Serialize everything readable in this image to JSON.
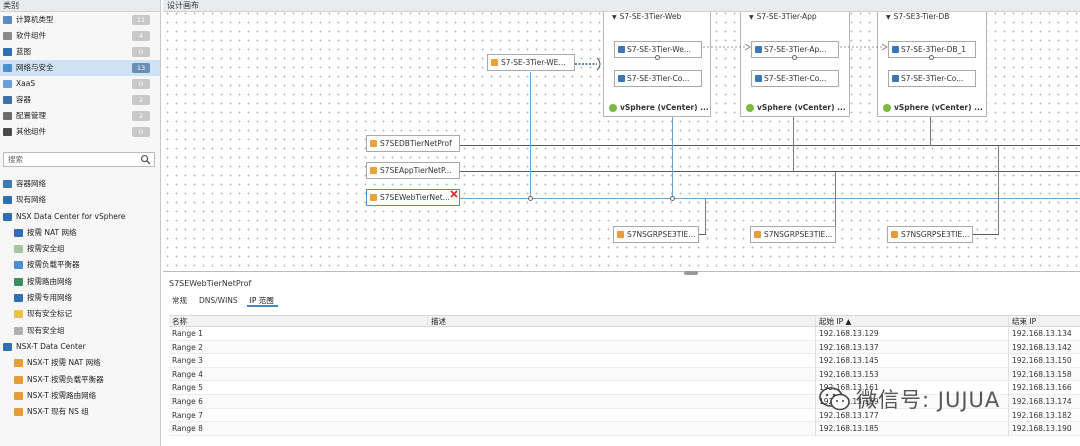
{
  "left_panel": {
    "title": "类别",
    "categories": [
      {
        "label": "计算机类型",
        "count": "11",
        "color": "#5b8cc0",
        "icon": "computer-type-icon"
      },
      {
        "label": "软件组件",
        "count": "4",
        "color": "#8a8a8a",
        "icon": "software-component-icon"
      },
      {
        "label": "蓝图",
        "count": "0",
        "color": "#2f6db5",
        "icon": "blueprint-icon"
      },
      {
        "label": "网络与安全",
        "count": "13",
        "color": "#4a8fd0",
        "icon": "network-security-icon"
      },
      {
        "label": "XaaS",
        "count": "0",
        "color": "#6aa0d8",
        "icon": "xaas-icon"
      },
      {
        "label": "容器",
        "count": "2",
        "color": "#3a6fa8",
        "icon": "container-icon"
      },
      {
        "label": "配置管理",
        "count": "2",
        "color": "#6b6b6b",
        "icon": "config-management-icon"
      },
      {
        "label": "其他组件",
        "count": "0",
        "color": "#4a4a4a",
        "icon": "other-component-icon"
      }
    ],
    "search_placeholder": "搜索",
    "tree": [
      {
        "label": "容器网络",
        "level": 0,
        "color": "#3a7ab8",
        "icon": "container-network-icon"
      },
      {
        "label": "现有网络",
        "level": 0,
        "color": "#2f6db5",
        "icon": "existing-network-icon"
      },
      {
        "label": "NSX Data Center for vSphere",
        "level": 0,
        "color": "#2f6db5",
        "icon": "nsx-v-icon"
      },
      {
        "label": "按需 NAT 网络",
        "level": 1,
        "color": "#2f6db5",
        "icon": "nat-network-icon"
      },
      {
        "label": "按需安全组",
        "level": 1,
        "color": "#a9c4a0",
        "icon": "security-group-icon"
      },
      {
        "label": "按需负载平衡器",
        "level": 1,
        "color": "#4a8fd0",
        "icon": "load-balancer-icon"
      },
      {
        "label": "按需路由网络",
        "level": 1,
        "color": "#3b8f5c",
        "icon": "routed-network-icon"
      },
      {
        "label": "按需专用网络",
        "level": 1,
        "color": "#2f6db5",
        "icon": "private-network-icon"
      },
      {
        "label": "现有安全标记",
        "level": 1,
        "color": "#e8c24a",
        "icon": "security-tag-icon"
      },
      {
        "label": "现有安全组",
        "level": 1,
        "color": "#b0b0b0",
        "icon": "existing-security-group-icon"
      },
      {
        "label": "NSX-T Data Center",
        "level": 0,
        "color": "#2f6db5",
        "icon": "nsx-t-icon"
      },
      {
        "label": "NSX-T 按需 NAT 网络",
        "level": 1,
        "color": "#e89a3c",
        "icon": "nsxt-nat-icon"
      },
      {
        "label": "NSX-T 按需负载平衡器",
        "level": 1,
        "color": "#e89a3c",
        "icon": "nsxt-lb-icon"
      },
      {
        "label": "NSX-T 按需路由网络",
        "level": 1,
        "color": "#e89a3c",
        "icon": "nsxt-routed-icon"
      },
      {
        "label": "NSX-T 现有 NS 组",
        "level": 1,
        "color": "#e89a3c",
        "icon": "nsxt-ns-group-icon"
      }
    ]
  },
  "canvas": {
    "title": "设计画布",
    "lb_node": "S7-SE-3Tier-WE...",
    "groups": [
      {
        "title": "S7-SE-3Tier-Web",
        "items": [
          "S7-SE-3Tier-We...",
          "S7-SE-3Tier-Co..."
        ],
        "footer": "vSphere (vCenter) ..."
      },
      {
        "title": "S7-SE-3Tier-App",
        "items": [
          "S7-SE-3Tier-Ap...",
          "S7-SE-3Tier-Co..."
        ],
        "footer": "vSphere (vCenter) ..."
      },
      {
        "title": "S7-SE3-Tier-DB",
        "items": [
          "S7-SE-3Tier-DB_1",
          "S7-SE-3Tier-Co..."
        ],
        "footer": "vSphere (vCenter) ..."
      }
    ],
    "networks": [
      "S7SEDBTierNetProf",
      "S7SEAppTierNetP...",
      "S7SEWebTierNet..."
    ],
    "nsgroups": [
      "S7NSGRPSE3TIE...",
      "S7NSGRPSE3TIE...",
      "S7NSGRPSE3TIE..."
    ]
  },
  "details": {
    "title": "S7SEWebTierNetProf",
    "tabs": [
      "常规",
      "DNS/WINS",
      "IP 范围"
    ],
    "columns": [
      "名称",
      "描述",
      "起始 IP ▲",
      "结束 IP"
    ],
    "rows": [
      [
        "Range 1",
        "",
        "192.168.13.129",
        "192.168.13.134"
      ],
      [
        "Range 2",
        "",
        "192.168.13.137",
        "192.168.13.142"
      ],
      [
        "Range 3",
        "",
        "192.168.13.145",
        "192.168.13.150"
      ],
      [
        "Range 4",
        "",
        "192.168.13.153",
        "192.168.13.158"
      ],
      [
        "Range 5",
        "",
        "192.168.13.161",
        "192.168.13.166"
      ],
      [
        "Range 6",
        "",
        "192.168.13.169",
        "192.168.13.174"
      ],
      [
        "Range 7",
        "",
        "192.168.13.177",
        "192.168.13.182"
      ],
      [
        "Range 8",
        "",
        "192.168.13.185",
        "192.168.13.190"
      ]
    ]
  },
  "watermark": "微信号: JUJUA"
}
